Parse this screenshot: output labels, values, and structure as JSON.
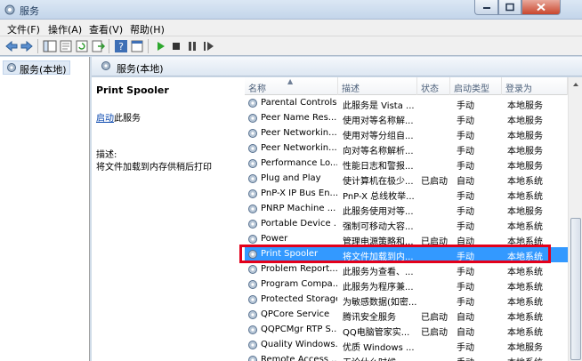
{
  "window": {
    "title": "服务"
  },
  "menu": [
    "文件(F)",
    "操作(A)",
    "查看(V)",
    "帮助(H)"
  ],
  "tree": {
    "item": "服务(本地)"
  },
  "pane_header": "服务(本地)",
  "detail": {
    "service_name": "Print Spooler",
    "stop_link": "启动",
    "stop_suffix": "此服务",
    "desc_label": "描述:",
    "desc_text": "将文件加载到内存供稍后打印"
  },
  "columns": [
    "名称",
    "描述",
    "状态",
    "启动类型",
    "登录为"
  ],
  "rows": [
    {
      "name": "Parental Controls",
      "desc": "此服务是 Vista ...",
      "status": "",
      "startup": "手动",
      "logon": "本地服务"
    },
    {
      "name": "Peer Name Res...",
      "desc": "使用对等名称解...",
      "status": "",
      "startup": "手动",
      "logon": "本地服务"
    },
    {
      "name": "Peer Networkin...",
      "desc": "使用对等分组自...",
      "status": "",
      "startup": "手动",
      "logon": "本地服务"
    },
    {
      "name": "Peer Networkin...",
      "desc": "向对等名称解析...",
      "status": "",
      "startup": "手动",
      "logon": "本地服务"
    },
    {
      "name": "Performance Lo...",
      "desc": "性能日志和警报...",
      "status": "",
      "startup": "手动",
      "logon": "本地服务"
    },
    {
      "name": "Plug and Play",
      "desc": "使计算机在极少...",
      "status": "已启动",
      "startup": "自动",
      "logon": "本地系统"
    },
    {
      "name": "PnP-X IP Bus En...",
      "desc": "PnP-X 总线枚举...",
      "status": "",
      "startup": "手动",
      "logon": "本地系统"
    },
    {
      "name": "PNRP Machine ...",
      "desc": "此服务使用对等...",
      "status": "",
      "startup": "手动",
      "logon": "本地服务"
    },
    {
      "name": "Portable Device ...",
      "desc": "强制可移动大容...",
      "status": "",
      "startup": "手动",
      "logon": "本地系统"
    },
    {
      "name": "Power",
      "desc": "管理电源策略和...",
      "status": "已启动",
      "startup": "自动",
      "logon": "本地系统"
    },
    {
      "name": "Print Spooler",
      "desc": "将文件加载到内...",
      "status": "",
      "startup": "手动",
      "logon": "本地系统",
      "selected": true
    },
    {
      "name": "Problem Report...",
      "desc": "此服务为查看、...",
      "status": "",
      "startup": "手动",
      "logon": "本地系统"
    },
    {
      "name": "Program Compa...",
      "desc": "此服务为程序兼...",
      "status": "",
      "startup": "手动",
      "logon": "本地系统"
    },
    {
      "name": "Protected Storage",
      "desc": "为敏感数据(如密...",
      "status": "",
      "startup": "手动",
      "logon": "本地系统"
    },
    {
      "name": "QPCore Service",
      "desc": "腾讯安全服务",
      "status": "已启动",
      "startup": "自动",
      "logon": "本地系统"
    },
    {
      "name": "QQPCMgr RTP S...",
      "desc": "QQ电脑管家实...",
      "status": "已启动",
      "startup": "自动",
      "logon": "本地系统"
    },
    {
      "name": "Quality Windows...",
      "desc": "优质 Windows ...",
      "status": "",
      "startup": "手动",
      "logon": "本地服务"
    },
    {
      "name": "Remote Access ...",
      "desc": "无论什么时候...",
      "status": "",
      "startup": "手动",
      "logon": "本地系统"
    }
  ],
  "colors": {
    "selection": "#3399ff",
    "highlight_box": "#e3001b",
    "link": "#0645ad"
  }
}
